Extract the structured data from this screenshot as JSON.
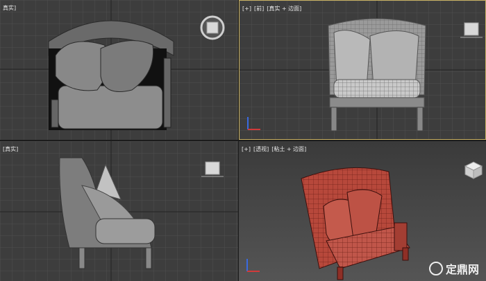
{
  "viewports": {
    "top_left": {
      "labels": [
        "真实]"
      ]
    },
    "top_right": {
      "labels": [
        "[+]",
        "[前]",
        "[真实 + 边面]"
      ]
    },
    "bottom_left": {
      "labels": [
        "[真实]"
      ]
    },
    "bottom_right": {
      "labels": [
        "[+]",
        "[透视]",
        "[粘土 + 边面]"
      ]
    }
  },
  "watermark": {
    "text": "定鼎网"
  },
  "colors": {
    "viewport_bg": "#3d3d3d",
    "grid_line": "#4f4f4f",
    "active_border": "#c9b162",
    "model_gray": "#8a8a8a",
    "model_red": "#b7483b"
  }
}
